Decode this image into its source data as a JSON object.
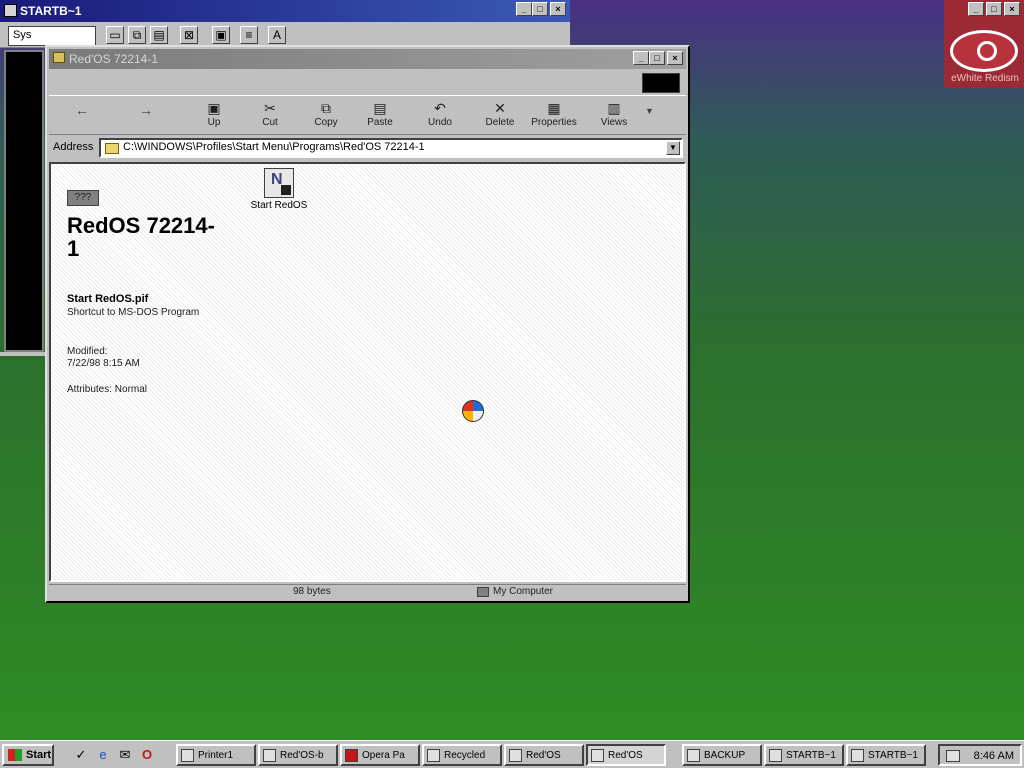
{
  "back_window": {
    "title": "STARTB~1",
    "sys_combo": "Sys",
    "toolbar_icons": [
      "keyboard-icon",
      "copy-icon",
      "paste-icon",
      "fullscreen-icon",
      "properties-icon",
      "font-icon"
    ]
  },
  "explorer": {
    "title": "Red'OS 72214-1",
    "toolbar": {
      "back": "Back",
      "forward": "Forward",
      "up": "Up",
      "cut": "Cut",
      "copy": "Copy",
      "paste": "Paste",
      "undo": "Undo",
      "delete": "Delete",
      "properties": "Properties",
      "views": "Views"
    },
    "address": {
      "label": "Address",
      "path": "C:\\WINDOWS\\Profiles\\Start Menu\\Programs\\Red'OS 72214-1"
    },
    "content": {
      "badge": "???",
      "folder_name": "RedOS 72214-1",
      "selected_name": "Start RedOS.pif",
      "selected_type": "Shortcut to MS-DOS Program",
      "modified_label": "Modified:",
      "modified_value": "7/22/98 8:15 AM",
      "attributes": "Attributes: Normal"
    },
    "file": {
      "name": "Start RedOS"
    },
    "status": {
      "left": "",
      "size": "98 bytes",
      "location": "My Computer"
    }
  },
  "red_logo": {
    "text": "eWhite Redism"
  },
  "taskbar": {
    "start": "Start",
    "quick_launch": [
      "desktop-icon",
      "ie-icon",
      "outlook-icon",
      "opera-icon"
    ],
    "tasks": [
      {
        "label": "Printer1",
        "icon": "printer-icon"
      },
      {
        "label": "Red'OS-b",
        "icon": "folder-icon"
      },
      {
        "label": "Opera Pa",
        "icon": "opera-icon"
      },
      {
        "label": "Recycled",
        "icon": "recycle-icon"
      },
      {
        "label": "Red'OS",
        "icon": "folder-icon"
      },
      {
        "label": "Red'OS",
        "icon": "folder-icon"
      },
      {
        "label": "BACKUP",
        "icon": "backup-icon"
      },
      {
        "label": "STARTB~1",
        "icon": "msdos-icon"
      },
      {
        "label": "STARTB~1",
        "icon": "msdos-icon"
      }
    ],
    "clock": "8:46 AM"
  }
}
